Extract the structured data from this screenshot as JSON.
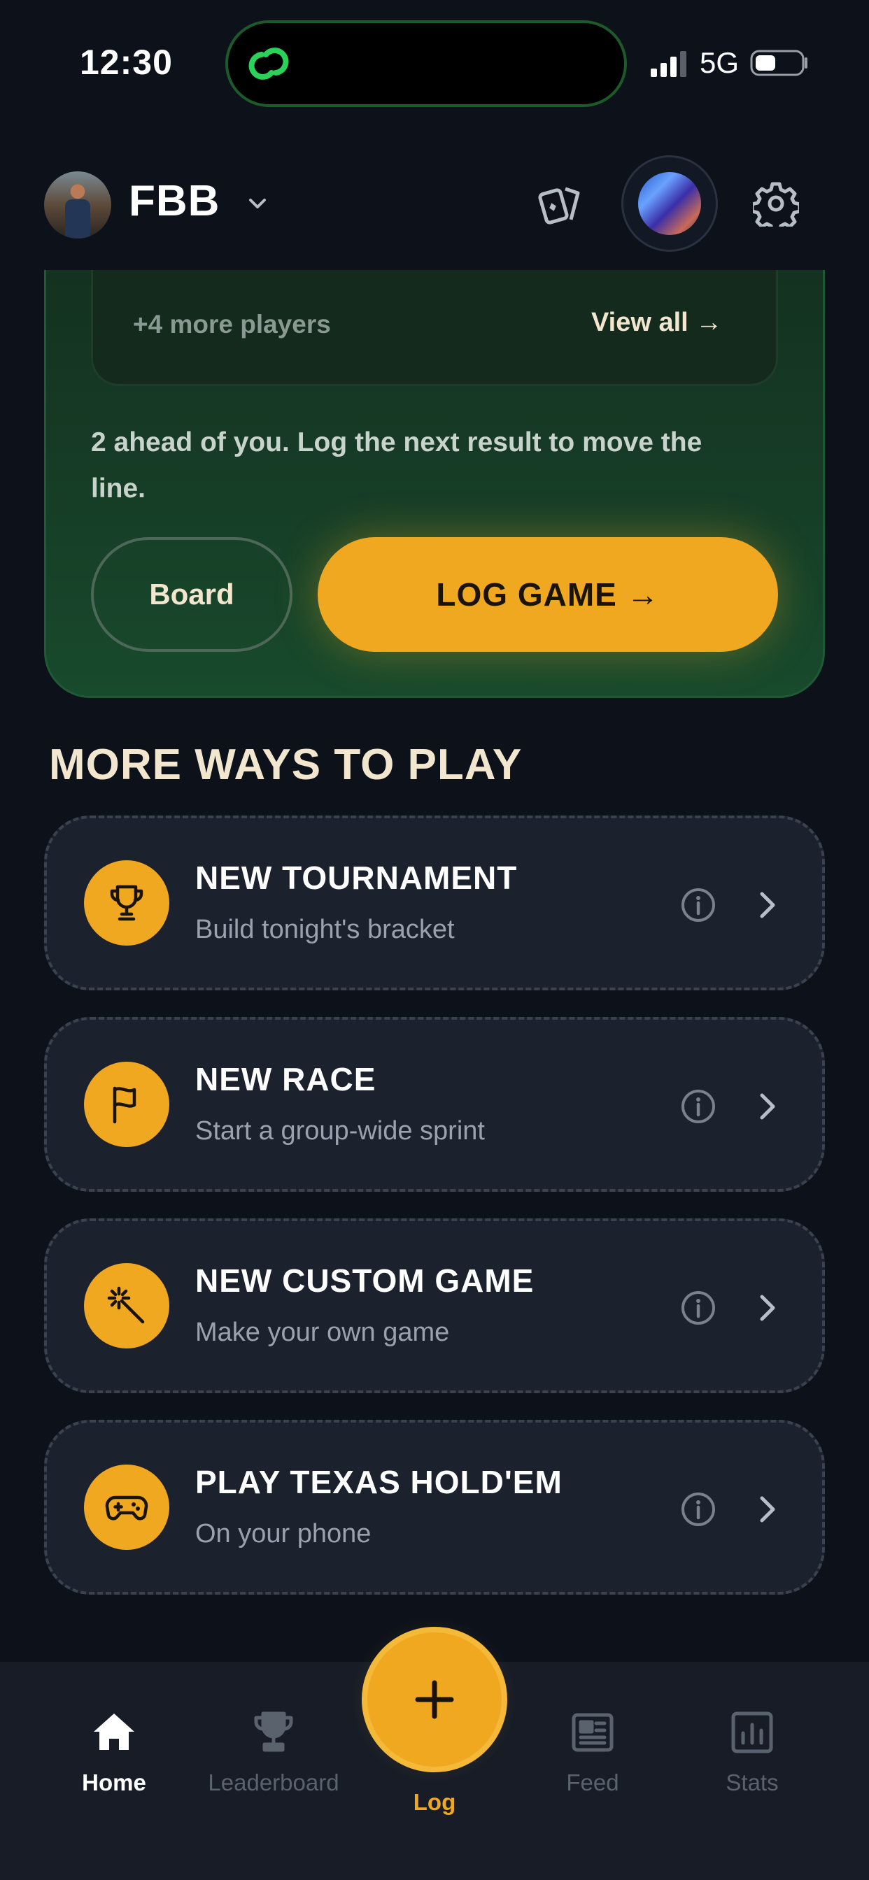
{
  "status_bar": {
    "time": "12:30",
    "network": "5G"
  },
  "header": {
    "group_name": "FBB"
  },
  "leaderboard_card": {
    "more_players": "+4 more players",
    "view_all": "View all →",
    "message": "2 ahead of you. Log the next result to move the line.",
    "board_button": "Board",
    "log_game_button": "LOG GAME →"
  },
  "more_ways": {
    "title": "MORE WAYS TO PLAY",
    "options": [
      {
        "title": "NEW TOURNAMENT",
        "subtitle": "Build tonight's bracket",
        "icon": "trophy-icon"
      },
      {
        "title": "NEW RACE",
        "subtitle": "Start a group-wide sprint",
        "icon": "flag-icon"
      },
      {
        "title": "NEW CUSTOM GAME",
        "subtitle": "Make your own game",
        "icon": "magic-wand-icon"
      },
      {
        "title": "PLAY TEXAS HOLD'EM",
        "subtitle": "On your phone",
        "icon": "gamepad-icon"
      }
    ]
  },
  "bottom_nav": {
    "items": [
      {
        "label": "Home",
        "icon": "home-icon",
        "active": true
      },
      {
        "label": "Leaderboard",
        "icon": "trophy-icon",
        "active": false
      },
      {
        "label": "Log",
        "icon": "plus-icon",
        "active": false
      },
      {
        "label": "Feed",
        "icon": "newspaper-icon",
        "active": false
      },
      {
        "label": "Stats",
        "icon": "bar-chart-icon",
        "active": false
      }
    ]
  },
  "colors": {
    "background": "#0c111a",
    "accent": "#f0a820",
    "card": "#1b212d",
    "green_card": "#163a25",
    "cream_text": "#f3e6cf"
  }
}
